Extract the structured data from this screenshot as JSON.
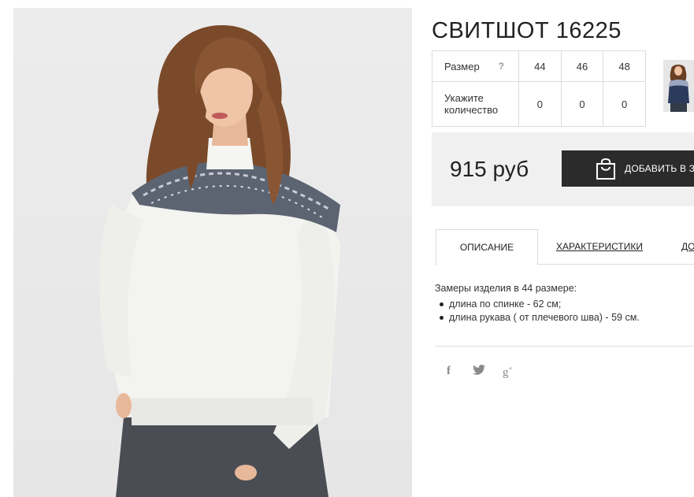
{
  "product": {
    "title": "СВИТШОТ 16225"
  },
  "size_table": {
    "size_label": "Размер",
    "help_mark": "?",
    "sizes": [
      "44",
      "46",
      "48"
    ],
    "quantity_label_line1": "Укажите",
    "quantity_label_line2": "количество",
    "quantities": [
      "0",
      "0",
      "0"
    ]
  },
  "buy": {
    "price": "915 руб",
    "add_to_cart": "ДОБАВИТЬ В ЗАКАЗ",
    "bag_icon": "shopping-bag-icon"
  },
  "tabs": [
    {
      "label": "ОПИСАНИЕ",
      "active": true
    },
    {
      "label": "ХАРАКТЕРИСТИКИ",
      "active": false
    },
    {
      "label": "ДОСТАВКА",
      "active": false
    }
  ],
  "description": {
    "intro": "Замеры изделия в 44 размере:",
    "items": [
      "длина по спинке - 62 см;",
      "длина рукава ( от плечевого шва) - 59 см."
    ]
  },
  "social": {
    "facebook": "f",
    "twitter": "𝕥",
    "google_plus": "g",
    "google_plus_sup": "+"
  },
  "colors": {
    "button_bg": "#2b2b2b",
    "panel_bg": "#f0f0f0",
    "border": "#dcdcdc"
  }
}
